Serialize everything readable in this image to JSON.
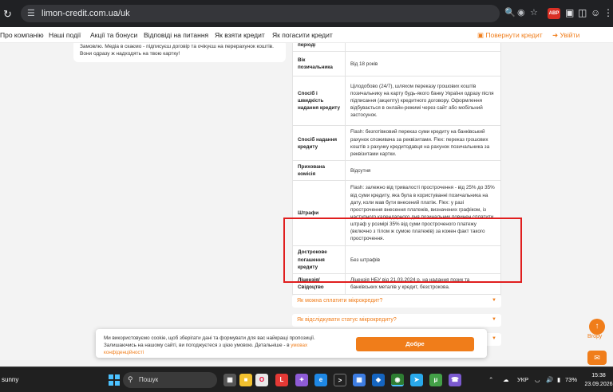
{
  "browser": {
    "url": "limon-credit.com.ua/uk",
    "avatar_badge": "ABP"
  },
  "nav": {
    "items": [
      "Про компанію",
      "Наші події",
      "Акції та бонуси",
      "Відповіді на питання",
      "Як взяти кредит",
      "Як погасити кредит"
    ],
    "return_credit": "Повернути кредит",
    "login": "Увійти"
  },
  "note": {
    "text": "Замовлю. Медіа в скаємо - підписуєш договір та очікуєш на перерахунок коштів. Вони одразу ж надходять на твою картку!"
  },
  "terms": {
    "rows": [
      {
        "label": "періоді",
        "value": ""
      },
      {
        "label": "Вік позичальника",
        "value": "Від 18 років"
      },
      {
        "label": "Спосіб і швидкість надання кредиту",
        "value": "Цілодобово (24/7), шляхом переказу грошових коштів позичальнику на карту будь-якого банку України одразу після підписання (акцепту) кредитного договору. Оформлення відбувається в онлайн-режимі через сайт або мобільний застосунок."
      },
      {
        "label": "Спосіб надання кредиту",
        "value": "Flash: безготівковий переказ суми кредиту на банківський рахунок споживача за реквізитами. Flex: переказ грошових коштів з рахунку кредитодавця на рахунок позичальника за реквізитами картки."
      },
      {
        "label": "Прихована комісія",
        "value": "Відсутня"
      },
      {
        "label": "Штрафи",
        "value": "Flash: залежно від тривалості прострочення - від 25% до 35% від суми кредиту, яка була в користуванні позичальника на дату, коли мав бути внесений платіж. Flex: у разі прострочення внесення платежів, визначених графіком, із наступного календарного дня позичальник повинен сплатити штраф у розмірі 35% від суми простроченого платежу (включно з тілом ж сумою платежів) за кожен факт такого прострочення."
      },
      {
        "label": "Дострокове погашення кредиту",
        "value": "Без штрафів"
      },
      {
        "label": "Ліцензія/ Свідоцтво",
        "value": "Ліцензія НБУ від 21.03.2024 р. на надання позик та банківських металів у кредит, безстрокова."
      }
    ]
  },
  "faq": {
    "items": [
      "Як можна сплатити мікрокредит?",
      "Як відслідкувати статус мікрокредиту?"
    ]
  },
  "cookie": {
    "text": "Ми використовуємо cookie, щоб зберігати дані та формувати для вас найкращі пропозиції. Залишаючись на нашому сайті, ви погоджуєтеся з цією умовою. Детальніше - в",
    "link": "умовах конфіденційності",
    "accept": "Добре"
  },
  "floating": {
    "up_label": "Вгору"
  },
  "taskbar": {
    "user": "sunny",
    "search_placeholder": "Пошук",
    "lang": "УКР",
    "battery": "73%",
    "time": "15:38",
    "date": "23.09.2026",
    "notif_count": "8"
  },
  "colors": {
    "accent": "#f07d1a",
    "highlight": "#e01e1e",
    "chrome_bg": "#202124",
    "taskbar_bg": "#202020"
  }
}
